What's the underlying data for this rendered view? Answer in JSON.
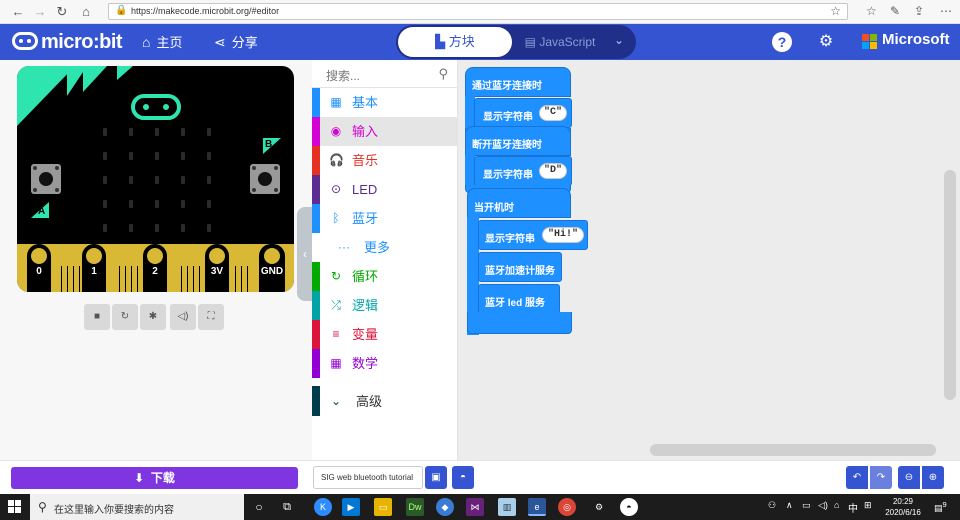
{
  "browser": {
    "url": "https://makecode.microbit.org/#editor"
  },
  "header": {
    "brand": "micro:bit",
    "home_label": "主页",
    "share_label": "分享",
    "blocks_tab": "方块",
    "js_tab": "JavaScript",
    "ms_label": "Microsoft",
    "accent": "#3454d1"
  },
  "simulator": {
    "button_a": "A",
    "button_b": "B",
    "pins": [
      "0",
      "1",
      "2",
      "3V",
      "GND"
    ]
  },
  "toolbox": {
    "search_placeholder": "搜索...",
    "categories": [
      {
        "label": "基本",
        "color": "#1e90ff",
        "icon": "grid-icon"
      },
      {
        "label": "输入",
        "color": "#d400d4",
        "icon": "target-icon"
      },
      {
        "label": "音乐",
        "color": "#e63022",
        "icon": "headphones-icon"
      },
      {
        "label": "LED",
        "color": "#5c2d91",
        "icon": "toggle-icon"
      },
      {
        "label": "蓝牙",
        "color": "#1e90ff",
        "icon": "bluetooth-icon"
      },
      {
        "label": "更多",
        "color": "#1e90ff",
        "icon": "dots-icon"
      },
      {
        "label": "循环",
        "color": "#00aa00",
        "icon": "loop-icon"
      },
      {
        "label": "逻辑",
        "color": "#00a4a6",
        "icon": "shuffle-icon"
      },
      {
        "label": "变量",
        "color": "#dc143c",
        "icon": "lines-icon"
      },
      {
        "label": "数学",
        "color": "#9400d3",
        "icon": "calculator-icon"
      },
      {
        "label": "高级",
        "color": "#003d4c",
        "icon": "chevron-down-icon"
      }
    ]
  },
  "workspace": {
    "blocks": [
      {
        "label": "通过蓝牙连接时"
      },
      {
        "label": "显示字符串",
        "value": "\"C\""
      },
      {
        "label": "断开蓝牙连接时"
      },
      {
        "label": "显示字符串",
        "value": "\"D\""
      },
      {
        "label": "当开机时"
      },
      {
        "label": "显示字符串",
        "value": "\"Hi!\""
      },
      {
        "label": "蓝牙加速计服务"
      },
      {
        "label": "蓝牙 led 服务"
      }
    ]
  },
  "bottom": {
    "download_label": "下载",
    "project_name": "SIG web bluetooth tutorial"
  },
  "taskbar": {
    "search_placeholder": "在这里输入你要搜索的内容",
    "time": "20:29",
    "date": "2020/6/16",
    "ime": "中",
    "notification_count": "9"
  }
}
